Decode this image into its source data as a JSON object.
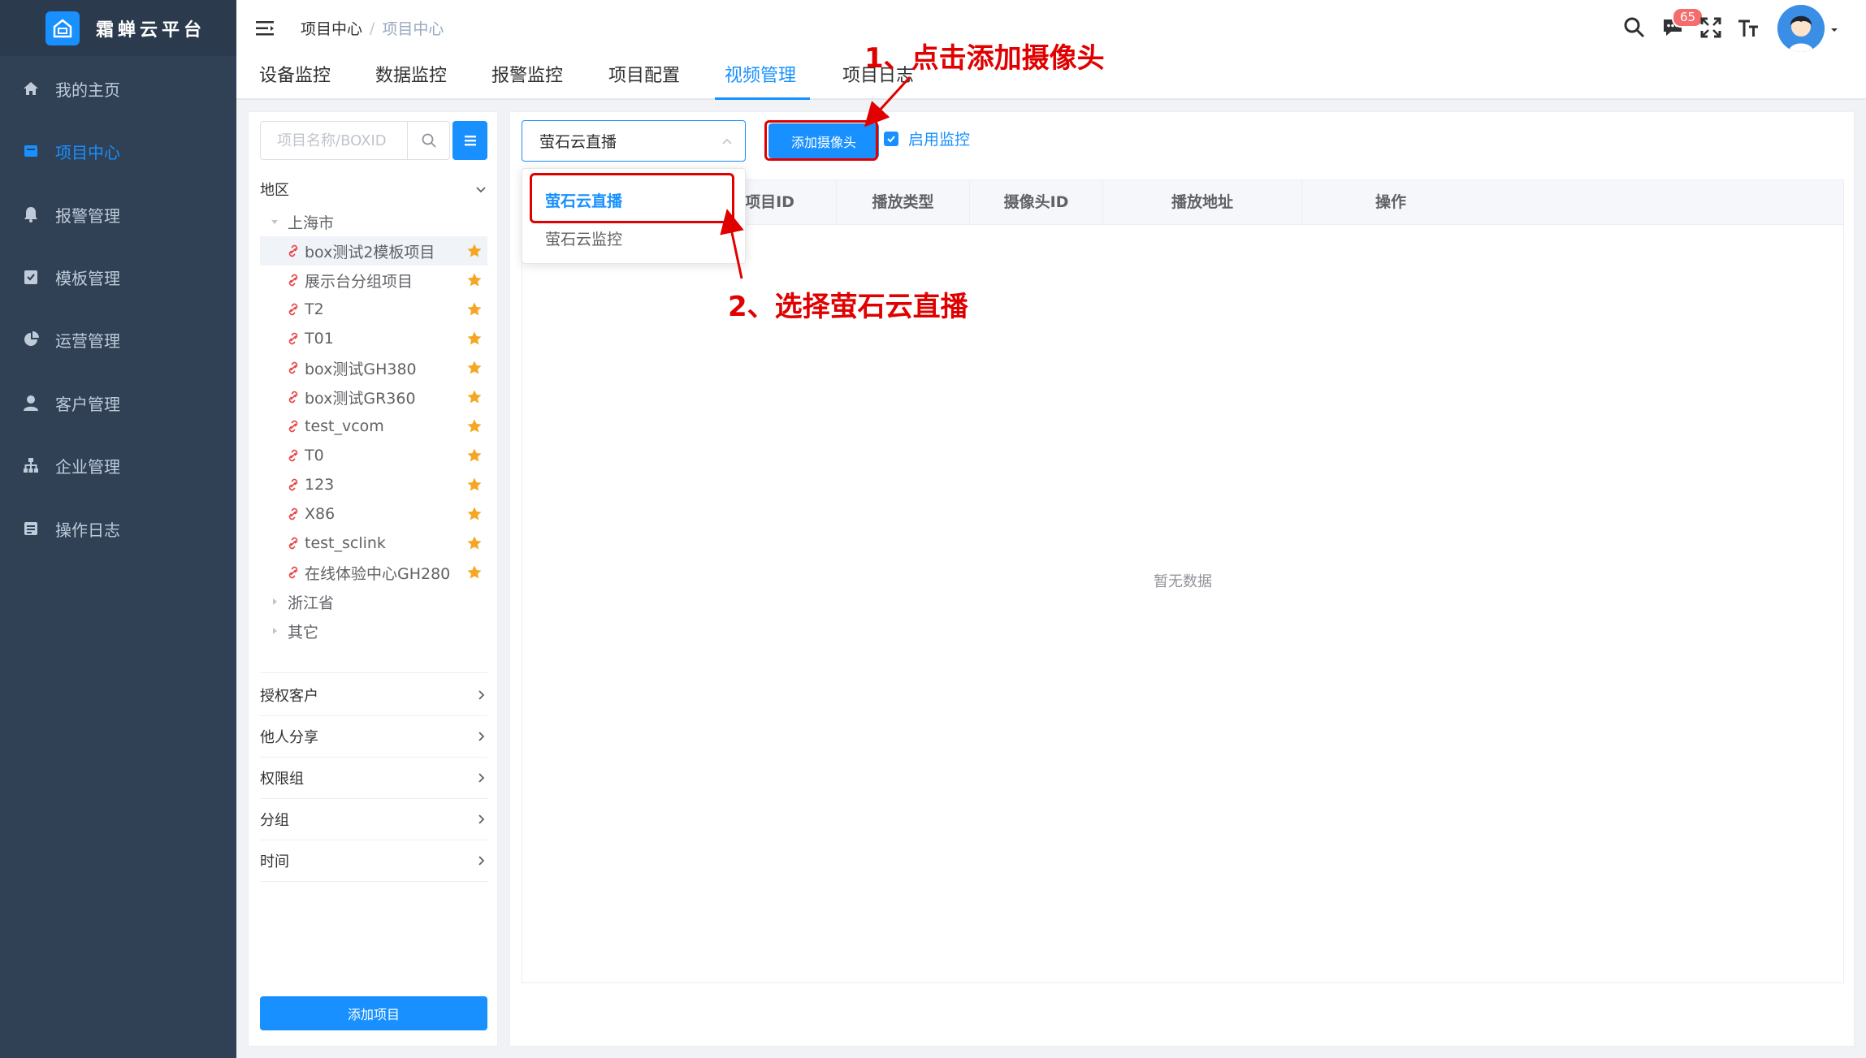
{
  "app": {
    "title": "霜蝉云平台",
    "accent": "#1890ff",
    "sidebar_bg": "#304156",
    "annotation_color": "#e00000"
  },
  "sidebar": {
    "items": [
      {
        "label": "我的主页",
        "icon": "home-icon"
      },
      {
        "label": "项目中心",
        "icon": "project-icon",
        "active": true
      },
      {
        "label": "报警管理",
        "icon": "bell-icon"
      },
      {
        "label": "模板管理",
        "icon": "checklist-icon"
      },
      {
        "label": "运营管理",
        "icon": "pie-chart-icon"
      },
      {
        "label": "客户管理",
        "icon": "user-icon"
      },
      {
        "label": "企业管理",
        "icon": "org-chart-icon"
      },
      {
        "label": "操作日志",
        "icon": "log-icon"
      }
    ]
  },
  "header": {
    "breadcrumb": [
      "项目中心",
      "项目中心"
    ],
    "breadcrumb_sep": "/",
    "message_count": "65"
  },
  "tabs": [
    {
      "label": "设备监控"
    },
    {
      "label": "数据监控"
    },
    {
      "label": "报警监控"
    },
    {
      "label": "项目配置"
    },
    {
      "label": "视频管理",
      "active": true
    },
    {
      "label": "项目日志"
    }
  ],
  "left_panel": {
    "search_placeholder": "项目名称/BOXID",
    "region_label": "地区",
    "tree": [
      {
        "label": "上海市",
        "expanded": true,
        "children": [
          "box测试2模板项目",
          "展示台分组项目",
          "T2",
          "T01",
          "box测试GH380",
          "box测试GR360",
          "test_vcom",
          "T0",
          "123",
          "X86",
          "test_sclink",
          "在线体验中心GH280"
        ]
      },
      {
        "label": "浙江省",
        "expanded": false
      },
      {
        "label": "其它",
        "expanded": false
      }
    ],
    "selected_item": "box测试2模板项目",
    "sections": [
      "授权客户",
      "他人分享",
      "权限组",
      "分组",
      "时间"
    ],
    "add_project_label": "添加项目"
  },
  "main": {
    "select_value": "萤石云直播",
    "add_camera_label": "添加摄像头",
    "enable_monitor_label": "启用监控",
    "enable_monitor_checked": true,
    "table_headers": [
      "项目ID",
      "播放类型",
      "摄像头ID",
      "播放地址",
      "操作"
    ],
    "empty_text": "暂无数据"
  },
  "dropdown": {
    "options": [
      "萤石云直播",
      "萤石云监控"
    ],
    "selected": "萤石云直播"
  },
  "annotations": {
    "step1": "1、点击添加摄像头",
    "step2": "2、选择萤石云直播"
  }
}
